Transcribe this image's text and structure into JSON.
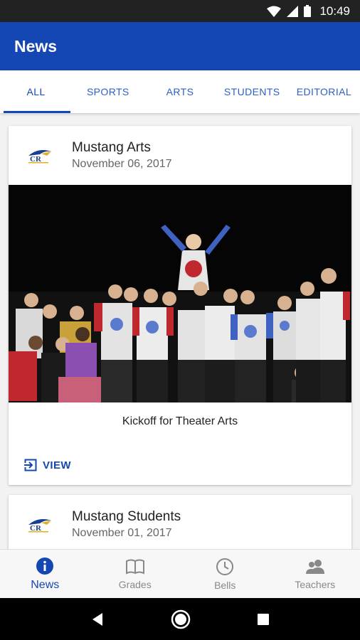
{
  "status_bar": {
    "time": "10:49",
    "icons": [
      "wifi-icon",
      "cell-signal-icon",
      "battery-icon"
    ]
  },
  "app_bar": {
    "title": "News"
  },
  "tabs": [
    {
      "label": "ALL",
      "active": true
    },
    {
      "label": "SPORTS",
      "active": false
    },
    {
      "label": "ARTS",
      "active": false
    },
    {
      "label": "STUDENTS",
      "active": false
    },
    {
      "label": "EDITORIAL",
      "active": false
    }
  ],
  "posts": [
    {
      "source": "Mustang Arts",
      "date": "November 06, 2017",
      "logo_text": "CR",
      "caption": "Kickoff for Theater Arts",
      "action_label": "VIEW",
      "image_icon": "theater-cast-photo"
    },
    {
      "source": "Mustang Students",
      "date": "November 01, 2017",
      "logo_text": "CR"
    }
  ],
  "bottom_nav": [
    {
      "label": "News",
      "icon": "info-icon",
      "active": true
    },
    {
      "label": "Grades",
      "icon": "book-icon",
      "active": false
    },
    {
      "label": "Bells",
      "icon": "clock-icon",
      "active": false
    },
    {
      "label": "Teachers",
      "icon": "people-icon",
      "active": false
    }
  ],
  "colors": {
    "primary": "#1447b3",
    "status_bar": "#222222",
    "inactive": "#888888"
  }
}
